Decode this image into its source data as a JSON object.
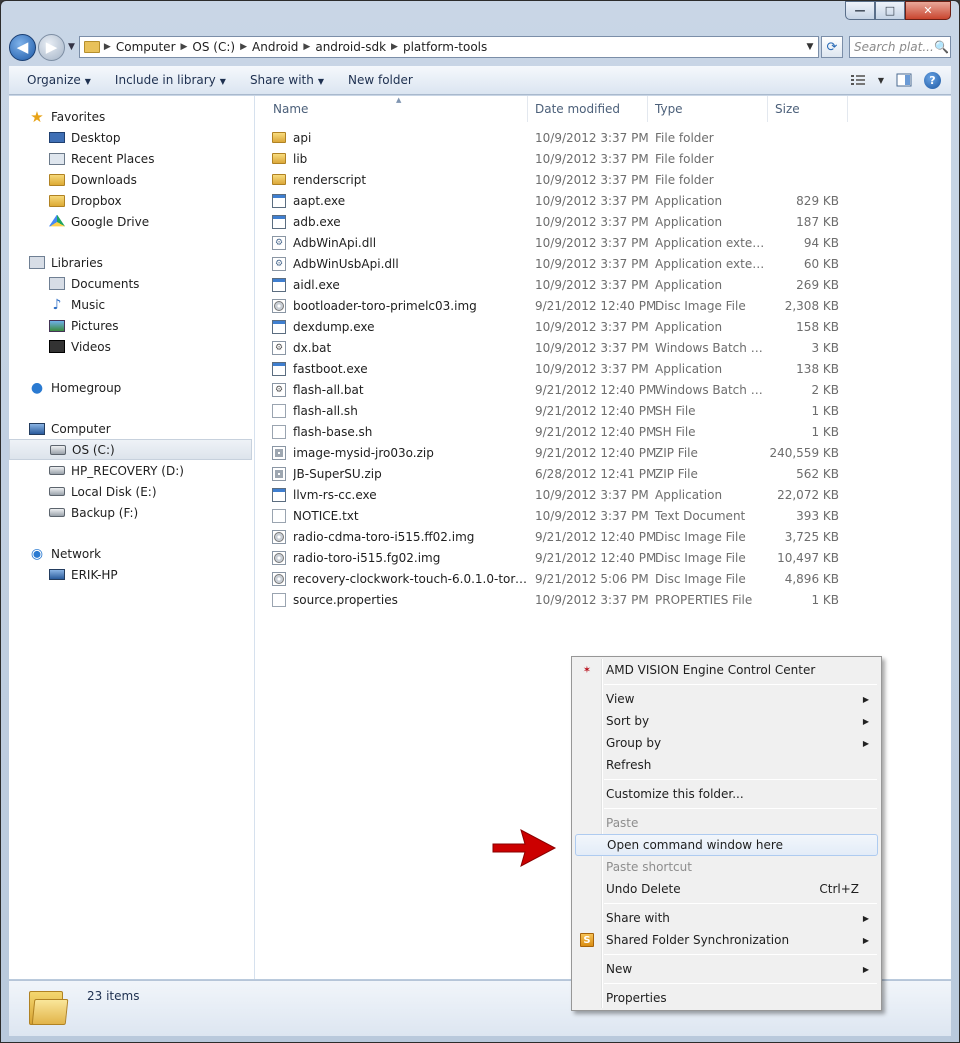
{
  "window": {
    "caption": {
      "minimize": "—",
      "maximize": "□",
      "close": "✕"
    }
  },
  "address": {
    "segments": [
      "Computer",
      "OS (C:)",
      "Android",
      "android-sdk",
      "platform-tools"
    ],
    "search_placeholder": "Search plat...",
    "back_icon": "back-arrow-icon",
    "forward_icon": "forward-arrow-icon"
  },
  "toolbar": {
    "organize": "Organize",
    "include_in_library": "Include in library",
    "share_with": "Share with",
    "new_folder": "New folder",
    "help": "?"
  },
  "nav": {
    "favorites": {
      "label": "Favorites",
      "items": [
        "Desktop",
        "Recent Places",
        "Downloads",
        "Dropbox",
        "Google Drive"
      ]
    },
    "libraries": {
      "label": "Libraries",
      "items": [
        "Documents",
        "Music",
        "Pictures",
        "Videos"
      ]
    },
    "homegroup": {
      "label": "Homegroup"
    },
    "computer": {
      "label": "Computer",
      "items": [
        "OS (C:)",
        "HP_RECOVERY (D:)",
        "Local Disk (E:)",
        "Backup (F:)"
      ],
      "selected": "OS (C:)"
    },
    "network": {
      "label": "Network",
      "items": [
        "ERIK-HP"
      ]
    }
  },
  "columns": {
    "name": "Name",
    "date": "Date modified",
    "type": "Type",
    "size": "Size"
  },
  "files": [
    {
      "name": "api",
      "date": "10/9/2012 3:37 PM",
      "type": "File folder",
      "size": "",
      "icon": "folder"
    },
    {
      "name": "lib",
      "date": "10/9/2012 3:37 PM",
      "type": "File folder",
      "size": "",
      "icon": "folder"
    },
    {
      "name": "renderscript",
      "date": "10/9/2012 3:37 PM",
      "type": "File folder",
      "size": "",
      "icon": "folder"
    },
    {
      "name": "aapt.exe",
      "date": "10/9/2012 3:37 PM",
      "type": "Application",
      "size": "829 KB",
      "icon": "app"
    },
    {
      "name": "adb.exe",
      "date": "10/9/2012 3:37 PM",
      "type": "Application",
      "size": "187 KB",
      "icon": "app"
    },
    {
      "name": "AdbWinApi.dll",
      "date": "10/9/2012 3:37 PM",
      "type": "Application extens...",
      "size": "94 KB",
      "icon": "dll"
    },
    {
      "name": "AdbWinUsbApi.dll",
      "date": "10/9/2012 3:37 PM",
      "type": "Application extens...",
      "size": "60 KB",
      "icon": "dll"
    },
    {
      "name": "aidl.exe",
      "date": "10/9/2012 3:37 PM",
      "type": "Application",
      "size": "269 KB",
      "icon": "app"
    },
    {
      "name": "bootloader-toro-primelc03.img",
      "date": "9/21/2012 12:40 PM",
      "type": "Disc Image File",
      "size": "2,308 KB",
      "icon": "disc"
    },
    {
      "name": "dexdump.exe",
      "date": "10/9/2012 3:37 PM",
      "type": "Application",
      "size": "158 KB",
      "icon": "app"
    },
    {
      "name": "dx.bat",
      "date": "10/9/2012 3:37 PM",
      "type": "Windows Batch File",
      "size": "3 KB",
      "icon": "bat"
    },
    {
      "name": "fastboot.exe",
      "date": "10/9/2012 3:37 PM",
      "type": "Application",
      "size": "138 KB",
      "icon": "app"
    },
    {
      "name": "flash-all.bat",
      "date": "9/21/2012 12:40 PM",
      "type": "Windows Batch File",
      "size": "2 KB",
      "icon": "bat"
    },
    {
      "name": "flash-all.sh",
      "date": "9/21/2012 12:40 PM",
      "type": "SH File",
      "size": "1 KB",
      "icon": "doc"
    },
    {
      "name": "flash-base.sh",
      "date": "9/21/2012 12:40 PM",
      "type": "SH File",
      "size": "1 KB",
      "icon": "doc"
    },
    {
      "name": "image-mysid-jro03o.zip",
      "date": "9/21/2012 12:40 PM",
      "type": "ZIP File",
      "size": "240,559 KB",
      "icon": "zip"
    },
    {
      "name": "JB-SuperSU.zip",
      "date": "6/28/2012 12:41 PM",
      "type": "ZIP File",
      "size": "562 KB",
      "icon": "zip"
    },
    {
      "name": "llvm-rs-cc.exe",
      "date": "10/9/2012 3:37 PM",
      "type": "Application",
      "size": "22,072 KB",
      "icon": "app"
    },
    {
      "name": "NOTICE.txt",
      "date": "10/9/2012 3:37 PM",
      "type": "Text Document",
      "size": "393 KB",
      "icon": "doc"
    },
    {
      "name": "radio-cdma-toro-i515.ff02.img",
      "date": "9/21/2012 12:40 PM",
      "type": "Disc Image File",
      "size": "3,725 KB",
      "icon": "disc"
    },
    {
      "name": "radio-toro-i515.fg02.img",
      "date": "9/21/2012 12:40 PM",
      "type": "Disc Image File",
      "size": "10,497 KB",
      "icon": "disc"
    },
    {
      "name": "recovery-clockwork-touch-6.0.1.0-toro.i...",
      "date": "9/21/2012 5:06 PM",
      "type": "Disc Image File",
      "size": "4,896 KB",
      "icon": "disc"
    },
    {
      "name": "source.properties",
      "date": "10/9/2012 3:37 PM",
      "type": "PROPERTIES File",
      "size": "1 KB",
      "icon": "doc"
    }
  ],
  "status": {
    "count": "23 items"
  },
  "context_menu": {
    "amd": "AMD VISION Engine Control Center",
    "view": "View",
    "sort_by": "Sort by",
    "group_by": "Group by",
    "refresh": "Refresh",
    "customize": "Customize this folder...",
    "paste": "Paste",
    "open_cmd": "Open command window here",
    "paste_shortcut": "Paste shortcut",
    "undo_delete": "Undo Delete",
    "undo_shortcut": "Ctrl+Z",
    "share_with": "Share with",
    "shared_sync": "Shared Folder Synchronization",
    "new": "New",
    "properties": "Properties",
    "submenu_glyph": "▶"
  },
  "colors": {
    "annotation_arrow": "#cc0000",
    "hover_border": "#aecbf0"
  }
}
